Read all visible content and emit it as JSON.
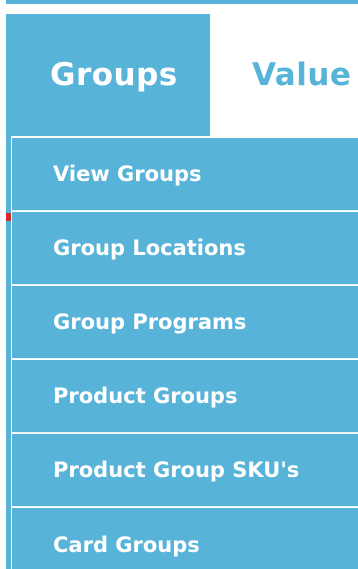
{
  "colors": {
    "nav_blue": "#58b3d8",
    "active_text": "#ffffff",
    "inactive_text": "#58b3d8",
    "accent_red": "#d42a2a"
  },
  "tabs": [
    {
      "label": "Groups",
      "active": true
    },
    {
      "label": "Value T",
      "active": false
    }
  ],
  "menu": {
    "items": [
      {
        "label": "View Groups"
      },
      {
        "label": "Group Locations"
      },
      {
        "label": "Group Programs"
      },
      {
        "label": "Product Groups"
      },
      {
        "label": "Product Group SKU's"
      },
      {
        "label": "Card Groups"
      }
    ]
  }
}
